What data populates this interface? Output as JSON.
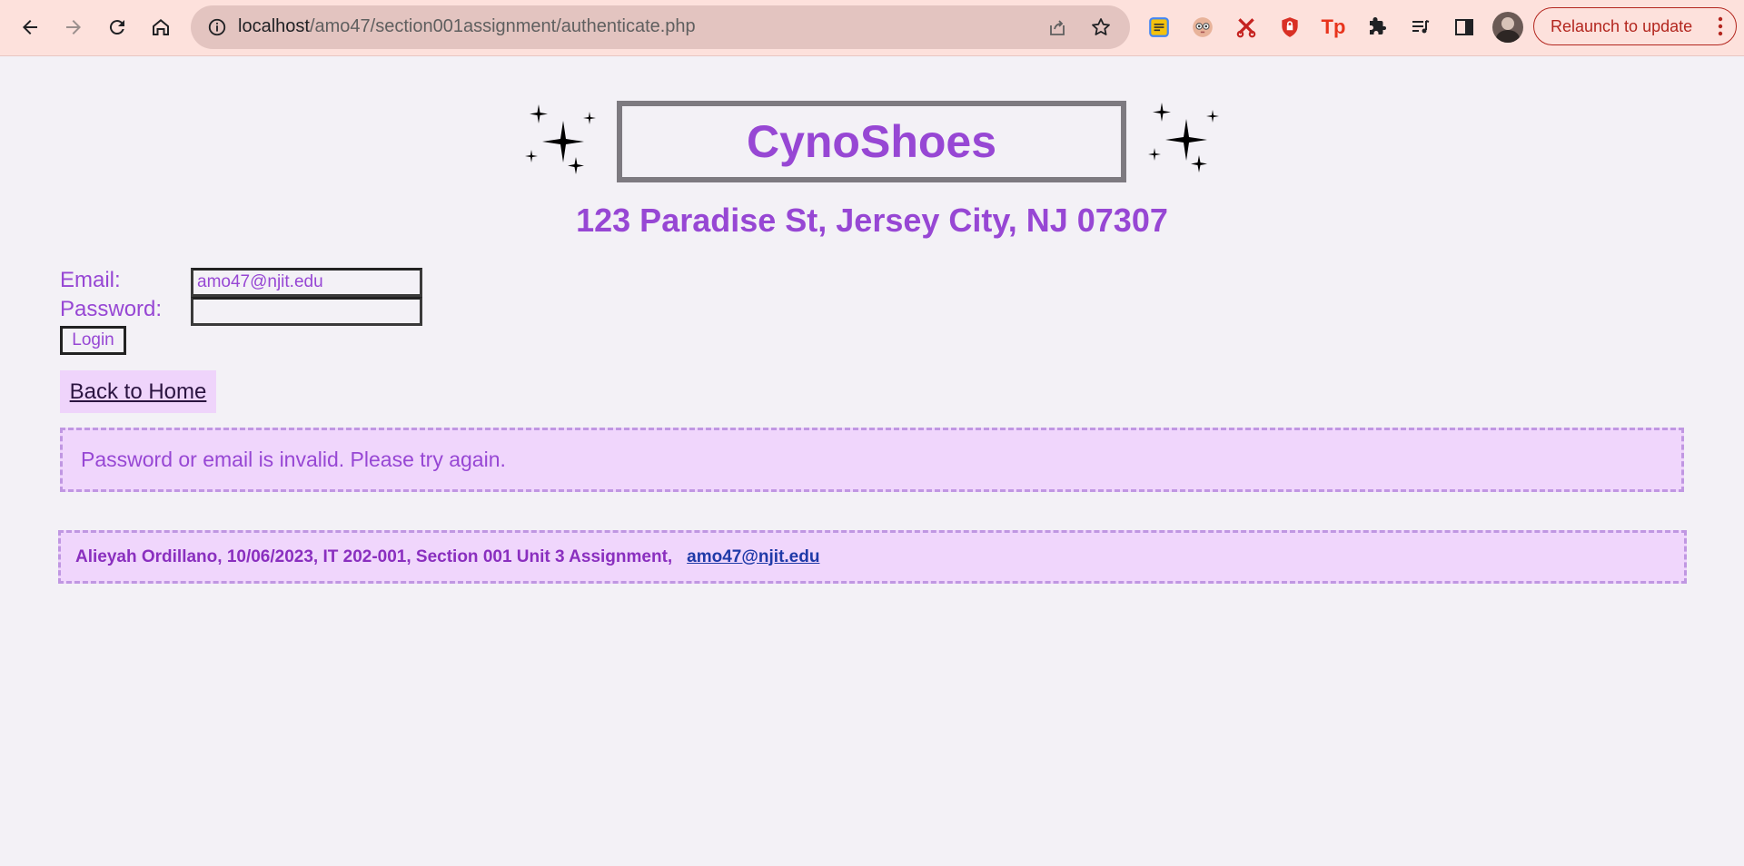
{
  "browser": {
    "url_host": "localhost",
    "url_path": "/amo47/section001assignment/authenticate.php",
    "relaunch_label": "Relaunch to update",
    "extensions": [
      "notes-extension-icon",
      "owl-extension-icon",
      "scissors-extension-icon",
      "shield-extension-icon",
      "tp-extension-icon",
      "puzzle-extensions-icon",
      "media-queue-icon",
      "side-panel-icon"
    ],
    "tp_label": "Tp"
  },
  "header": {
    "brand": "CynoShoes",
    "address": "123 Paradise St, Jersey City, NJ 07307"
  },
  "login_form": {
    "email_label": "Email:",
    "email_value": "amo47@njit.edu",
    "password_label": "Password:",
    "password_value": "",
    "login_button": "Login"
  },
  "nav": {
    "back_home": "Back to Home"
  },
  "error": {
    "message": "Password or email is invalid. Please try again."
  },
  "footer": {
    "credits": "Alieyah Ordillano, 10/06/2023, IT 202-001, Section 001 Unit 3 Assignment,",
    "email": "amo47@njit.edu"
  },
  "colors": {
    "brand_purple": "#9747d4",
    "panel_background": "#f0d6fc",
    "dashed_border": "#c097e2",
    "chrome_background": "#fde1dc",
    "relaunch_red": "#b3261e"
  }
}
